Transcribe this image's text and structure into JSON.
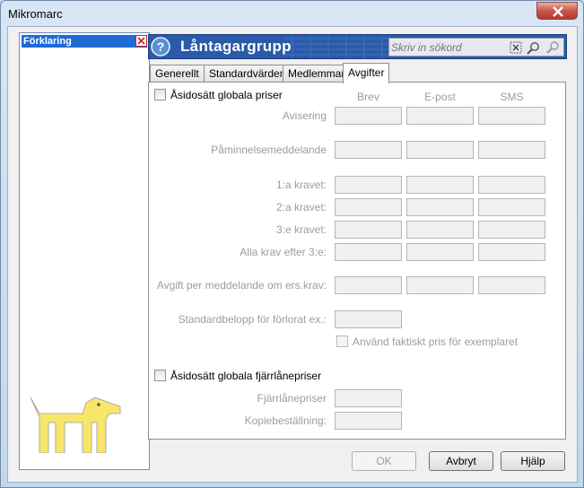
{
  "window": {
    "title": "Mikromarc"
  },
  "left_pane": {
    "header": "Förklaring"
  },
  "banner": {
    "title": "Låntagargrupp",
    "search_placeholder": "Skriv in sökord"
  },
  "tabs": [
    {
      "label": "Generellt",
      "active": false
    },
    {
      "label": "Standardvärden",
      "active": false
    },
    {
      "label": "Medlemmar",
      "active": false
    },
    {
      "label": "Avgifter",
      "active": true
    }
  ],
  "fees": {
    "override_global_prices": "Åsidosätt globala priser",
    "columns": [
      "Brev",
      "E-post",
      "SMS"
    ],
    "rows": {
      "avisering": "Avisering",
      "paminnelse": "Påminnelsemeddelande",
      "krav1": "1:a kravet:",
      "krav2": "2:a kravet:",
      "krav3": "3:e kravet:",
      "krav_efter3": "Alla krav efter 3:e:",
      "avgift_per_meddelande": "Avgift per meddelande om ers.krav:",
      "standardbelopp": "Standardbelopp för förlorat ex.:"
    },
    "use_actual_price": "Använd faktiskt pris för exemplaret",
    "override_ill_prices": "Åsidosätt globala fjärrlånepriser",
    "ill_price": "Fjärrlånepriser",
    "copy_order": "Kopiebeställning:"
  },
  "buttons": {
    "ok": "OK",
    "cancel": "Avbryt",
    "help": "Hjälp"
  }
}
